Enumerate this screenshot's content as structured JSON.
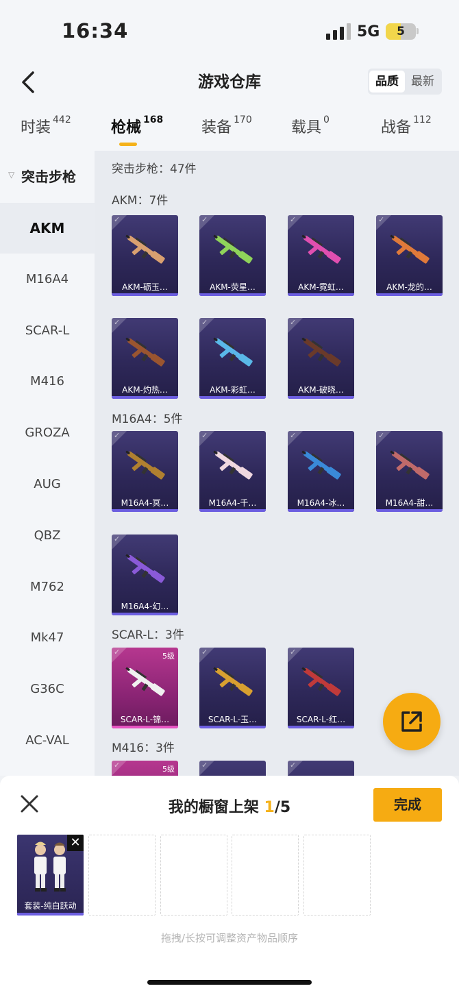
{
  "status": {
    "time": "16:34",
    "network": "5G",
    "battery": "5",
    "battery_level": 0.5
  },
  "header": {
    "title": "游戏仓库",
    "sort_options": [
      "品质",
      "最新"
    ],
    "sort_selected": "品质"
  },
  "tabs": [
    {
      "label": "时装",
      "count": "442"
    },
    {
      "label": "枪械",
      "count": "168"
    },
    {
      "label": "装备",
      "count": "170"
    },
    {
      "label": "载具",
      "count": "0"
    },
    {
      "label": "战备",
      "count": "112"
    }
  ],
  "sidebar": {
    "category": "突击步枪",
    "items": [
      "AKM",
      "M16A4",
      "SCAR-L",
      "M416",
      "GROZA",
      "AUG",
      "QBZ",
      "M762",
      "Mk47",
      "G36C",
      "AC-VAL"
    ],
    "selected": "AKM"
  },
  "main": {
    "category_summary": "突击步枪：47件",
    "sections": [
      {
        "title": "AKM：7件",
        "items": [
          {
            "name": "AKM-砺玉…",
            "gun_color": "#d9a070"
          },
          {
            "name": "AKM-荧星…",
            "gun_color": "#8fd35a"
          },
          {
            "name": "AKM-霓虹…",
            "gun_color": "#e04fb0"
          },
          {
            "name": "AKM-龙的…",
            "gun_color": "#e07a3a"
          },
          {
            "name": "AKM-灼热…",
            "gun_color": "#9a5530"
          },
          {
            "name": "AKM-彩虹…",
            "gun_color": "#5ab8e8"
          },
          {
            "name": "AKM-破晓…",
            "gun_color": "#6a3a2a"
          }
        ]
      },
      {
        "title": "M16A4：5件",
        "items": [
          {
            "name": "M16A4-冥…",
            "gun_color": "#b08030"
          },
          {
            "name": "M16A4-千…",
            "gun_color": "#f0d8e0"
          },
          {
            "name": "M16A4-冰…",
            "gun_color": "#3a8ad8"
          },
          {
            "name": "M16A4-甜…",
            "gun_color": "#c06a6a"
          },
          {
            "name": "M16A4-幻…",
            "gun_color": "#8a5ad8"
          }
        ]
      },
      {
        "title": "SCAR-L：3件",
        "items": [
          {
            "name": "SCAR-L-锦…",
            "gun_color": "#f0f0f0",
            "level": "5级",
            "pink": true
          },
          {
            "name": "SCAR-L-玉…",
            "gun_color": "#d8a030"
          },
          {
            "name": "SCAR-L-红…",
            "gun_color": "#c03a3a"
          }
        ]
      },
      {
        "title": "M416：3件",
        "items": [
          {
            "name": "",
            "level": "5级",
            "pink": true
          },
          {
            "name": ""
          },
          {
            "name": ""
          }
        ]
      }
    ]
  },
  "showcase": {
    "title_prefix": "我的橱窗上架 ",
    "count": "1",
    "total": "/5",
    "done_label": "完成",
    "slot_item_name": "套装-纯白跃动",
    "hint": "拖拽/长按可调整资产物品顺序"
  },
  "colors": {
    "accent": "#f6ab12",
    "card_bg": "#2e2859",
    "card_bar": "#6c5ee0",
    "pink": "#b6378f"
  }
}
